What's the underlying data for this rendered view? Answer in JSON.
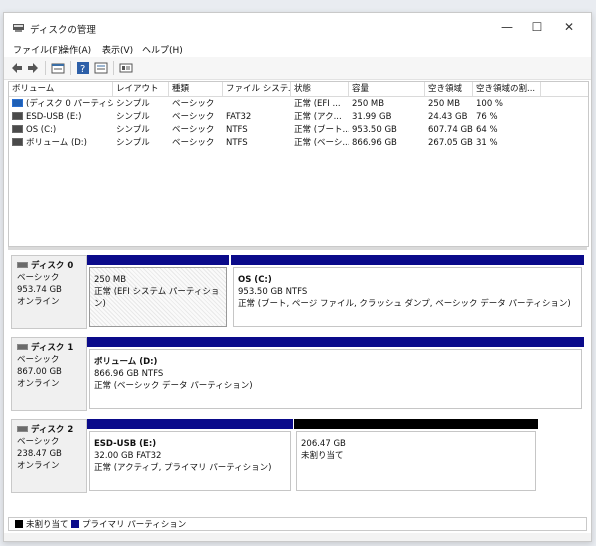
{
  "window": {
    "title": "ディスクの管理"
  },
  "window_controls": {
    "minimize": "—",
    "maximize": "☐",
    "close": "✕"
  },
  "menu": [
    "ファイル(F)",
    "操作(A)",
    "表示(V)",
    "ヘルプ(H)"
  ],
  "table": {
    "columns": [
      "ボリューム",
      "レイアウト",
      "種類",
      "ファイル システム",
      "状態",
      "容量",
      "空き領域",
      "空き領域の割..."
    ],
    "rows": [
      {
        "vol": "(ディスク 0 パーティション 1)",
        "layout": "シンプル",
        "type": "ベーシック",
        "fs": "",
        "status": "正常 (EFI ...",
        "cap": "250 MB",
        "free": "250 MB",
        "pct": "100 %"
      },
      {
        "vol": "ESD-USB (E:)",
        "layout": "シンプル",
        "type": "ベーシック",
        "fs": "FAT32",
        "status": "正常 (アク...",
        "cap": "31.99 GB",
        "free": "24.43 GB",
        "pct": "76 %"
      },
      {
        "vol": "OS (C:)",
        "layout": "シンプル",
        "type": "ベーシック",
        "fs": "NTFS",
        "status": "正常 (ブート...",
        "cap": "953.50 GB",
        "free": "607.74 GB",
        "pct": "64 %"
      },
      {
        "vol": "ボリューム (D:)",
        "layout": "シンプル",
        "type": "ベーシック",
        "fs": "NTFS",
        "status": "正常 (ベーシ...",
        "cap": "866.96 GB",
        "free": "267.05 GB",
        "pct": "31 %"
      }
    ]
  },
  "disks": [
    {
      "name": "ディスク 0",
      "type": "ベーシック",
      "size": "953.74 GB",
      "state": "オンライン",
      "partitions": [
        {
          "name": "",
          "size": "250 MB",
          "desc": "正常 (EFI システム パーティション)"
        },
        {
          "name": "OS (C:)",
          "size": "953.50 GB NTFS",
          "desc": "正常 (ブート, ページ ファイル, クラッシュ ダンプ, ベーシック データ パーティション)"
        }
      ]
    },
    {
      "name": "ディスク 1",
      "type": "ベーシック",
      "size": "867.00 GB",
      "state": "オンライン",
      "partitions": [
        {
          "name": "ボリューム (D:)",
          "size": "866.96 GB NTFS",
          "desc": "正常 (ベーシック データ パーティション)"
        }
      ]
    },
    {
      "name": "ディスク 2",
      "type": "ベーシック",
      "size": "238.47 GB",
      "state": "オンライン",
      "partitions": [
        {
          "name": "ESD-USB (E:)",
          "size": "32.00 GB FAT32",
          "desc": "正常 (アクティブ, プライマリ パーティション)"
        },
        {
          "name": "",
          "size": "206.47 GB",
          "desc": "未割り当て"
        }
      ]
    }
  ],
  "legend": {
    "unallocated": "未割り当て",
    "primary": "プライマリ パーティション"
  },
  "colors": {
    "primary": "#0a0a8a",
    "unallocated": "#000000"
  }
}
